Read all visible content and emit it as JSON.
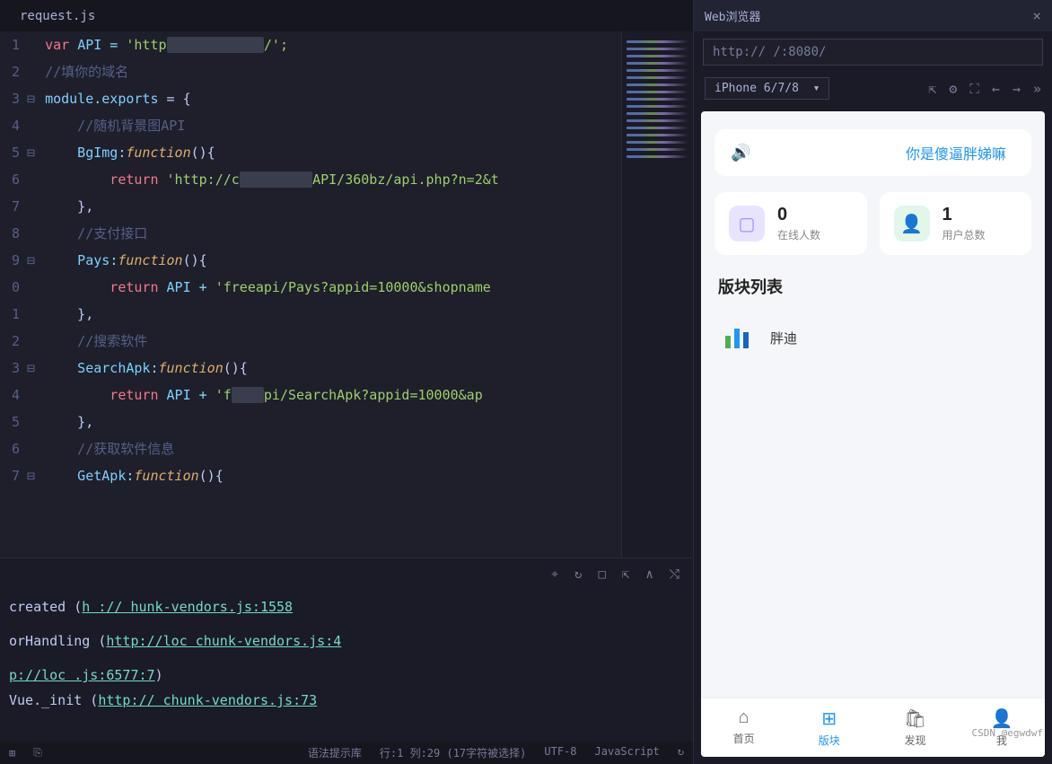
{
  "tab": {
    "filename": "request.js"
  },
  "code": {
    "lines": [
      "1",
      "2",
      "3",
      "4",
      "5",
      "6",
      "7",
      "8",
      "9",
      "0",
      "1",
      "2",
      "3",
      "4",
      "5",
      "6",
      "7"
    ],
    "l1": {
      "var": "var",
      "api": "API",
      "eq": " = ",
      "str1": "'http",
      "obscured": "xxxxxxxxxxxx",
      "str2": "/';"
    },
    "l2": "//填你的域名",
    "l3": {
      "mod": "module",
      "dot": ".",
      "exp": "exports",
      "rest": " = {"
    },
    "l4": "    //随机背景图API",
    "l5": {
      "key": "    BgImg",
      "col": ":",
      "fn": "function",
      "rest": "(){"
    },
    "l6": {
      "ret": "        return ",
      "s1": "'http://c",
      "ob": "xxxxxxxxx",
      "s2": "API/360bz/api.php?n=2&t"
    },
    "l7": "    },",
    "l8": "    //支付接口",
    "l9": {
      "key": "    Pays",
      "col": ":",
      "fn": "function",
      "rest": "(){"
    },
    "l10": {
      "ret": "        return ",
      "api": "API",
      "plus": " + ",
      "str": "'freeapi/Pays?appid=10000&shopname"
    },
    "l11": "    },",
    "l12": "    //搜索软件",
    "l13": {
      "key": "    SearchApk",
      "col": ":",
      "fn": "function",
      "rest": "(){"
    },
    "l14": {
      "ret": "        return ",
      "api": "API",
      "plus": " + ",
      "s1": "'f",
      "ob": "xxxx",
      "s2": "pi/SearchApk?appid=10000&ap"
    },
    "l15": "    },",
    "l16": "    //获取软件信息",
    "l17": {
      "key": "    GetApk",
      "col": ":",
      "fn": "function",
      "rest": "(){"
    }
  },
  "console": {
    "l1": {
      "pre": "created (",
      "link": "h   ://                              hunk-vendors.js:1558"
    },
    "l2": {
      "pre": "orHandling (",
      "link": "http://loc                        chunk-vendors.js:4"
    },
    "l3": {
      "link": "p://loc                                .js:6577:7",
      "post": ")"
    },
    "l4": {
      "pre": "Vue._init (",
      "link": "http://                       chunk-vendors.js:73"
    }
  },
  "statusbar": {
    "syntax": "语法提示库",
    "pos": "行:1 列:29 (17字符被选择)",
    "encoding": "UTF-8",
    "lang": "JavaScript"
  },
  "browser": {
    "title": "Web浏览器",
    "url": "http://         /:8080/",
    "device": "iPhone 6/7/8",
    "banner_text": "你是傻逼胖娣嘛",
    "stat1_value": "0",
    "stat1_label": "在线人数",
    "stat2_value": "1",
    "stat2_label": "用户总数",
    "section": "版块列表",
    "block1": "胖迪",
    "nav": [
      "首页",
      "版块",
      "发现",
      "我"
    ]
  },
  "watermark": "CSDN @egwdwf"
}
